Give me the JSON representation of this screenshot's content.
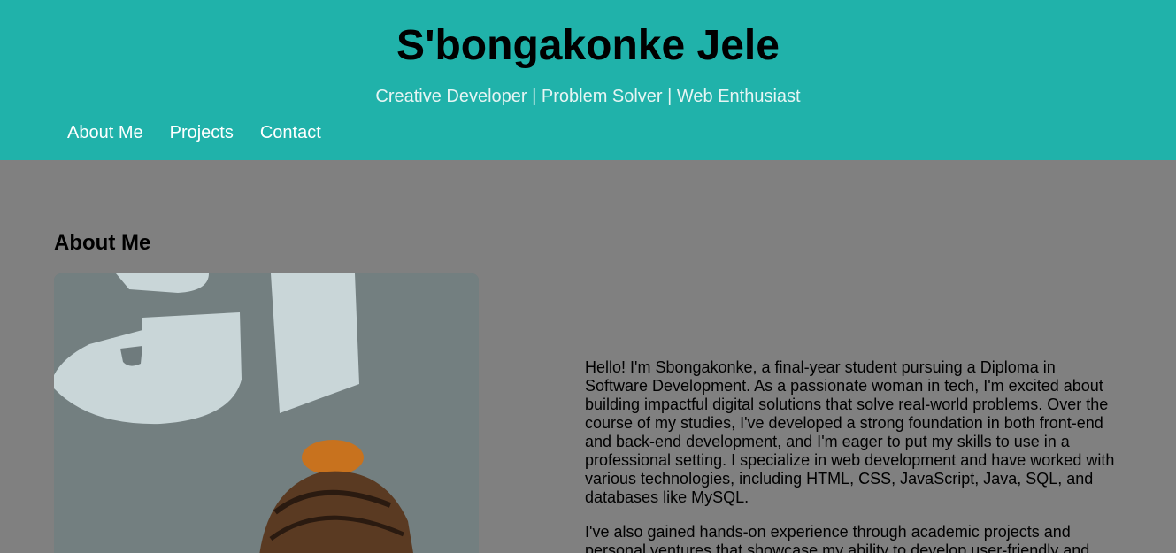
{
  "header": {
    "title": "S'bongakonke Jele",
    "tagline": "Creative Developer | Problem Solver | Web Enthusiast"
  },
  "nav": {
    "items": [
      {
        "label": "About Me"
      },
      {
        "label": "Projects"
      },
      {
        "label": "Contact"
      }
    ]
  },
  "about": {
    "heading": "About Me",
    "paragraphs": [
      "Hello! I'm Sbongakonke, a final-year student pursuing a Diploma in Software Development. As a passionate woman in tech, I'm excited about building impactful digital solutions that solve real-world problems. Over the course of my studies, I've developed a strong foundation in both front-end and back-end development, and I'm eager to put my skills to use in a professional setting. I specialize in web development and have worked with various technologies, including HTML, CSS, JavaScript, Java, SQL, and databases like MySQL.",
      "I've also gained hands-on experience through academic projects and personal ventures that showcase my ability to develop user-friendly and"
    ]
  },
  "colors": {
    "header_bg": "#20b2aa",
    "page_bg": "#808080"
  }
}
